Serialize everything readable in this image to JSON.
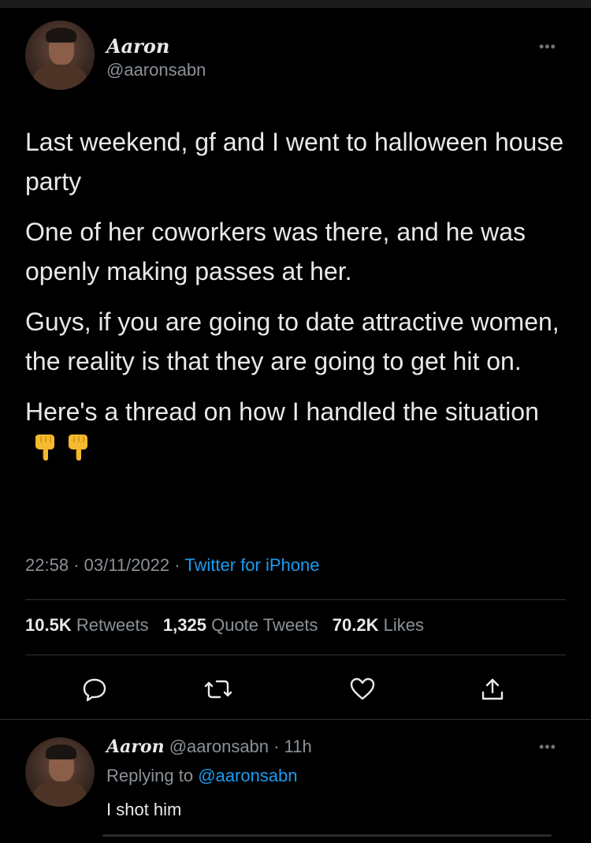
{
  "tweet": {
    "author_name": "Aaron",
    "author_handle": "@aaronsabn",
    "paragraphs": [
      "Last weekend, gf and I went to halloween house party",
      "One of her coworkers was there, and he was openly making passes at her.",
      "Guys, if you are going to date attractive women, the reality is that they are going to get hit on.",
      "Here's a thread on how I handled the situation"
    ],
    "emoji_icons": [
      "backhand-index-pointing-down-icon",
      "backhand-index-pointing-down-icon"
    ],
    "time": "22:58",
    "date": "03/11/2022",
    "source": "Twitter for iPhone",
    "separator": "·",
    "stats": {
      "retweets_count": "10.5K",
      "retweets_label": "Retweets",
      "quotes_count": "1,325",
      "quotes_label": "Quote Tweets",
      "likes_count": "70.2K",
      "likes_label": "Likes"
    },
    "actions": [
      "reply-icon",
      "retweet-icon",
      "like-icon",
      "share-icon"
    ]
  },
  "reply": {
    "author_name": "Aaron",
    "author_handle": "@aaronsabn",
    "time_ago": "11h",
    "replying_prefix": "Replying to",
    "replying_to": "@aaronsabn",
    "text": "I shot him"
  },
  "colors": {
    "background": "#000000",
    "text": "#e7e9ea",
    "muted": "#8b9197",
    "accent": "#1d9bf0",
    "divider": "#2f3336"
  }
}
